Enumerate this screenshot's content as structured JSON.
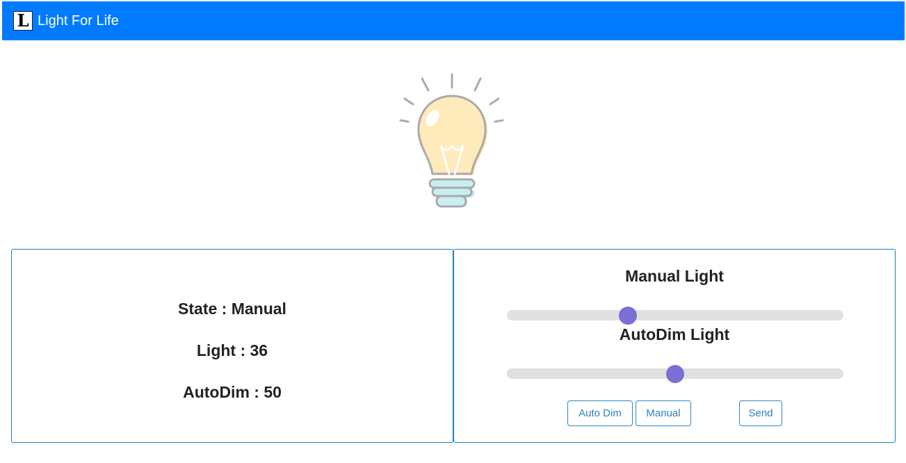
{
  "navbar": {
    "logo_letter": "L",
    "brand": "Light For Life",
    "color": "#007bff"
  },
  "bulb": {
    "icon": "lightbulb-icon"
  },
  "status": {
    "state": "State : Manual",
    "light": "Light : 36",
    "autodim": "AutoDim : 50"
  },
  "controls": {
    "manual_title": "Manual Light",
    "manual_value": 36,
    "autodim_title": "AutoDim Light",
    "autodim_value": 50,
    "thumb_color": "#7b6fd4",
    "buttons": {
      "auto_dim": "Auto Dim",
      "manual": "Manual",
      "send": "Send"
    }
  }
}
